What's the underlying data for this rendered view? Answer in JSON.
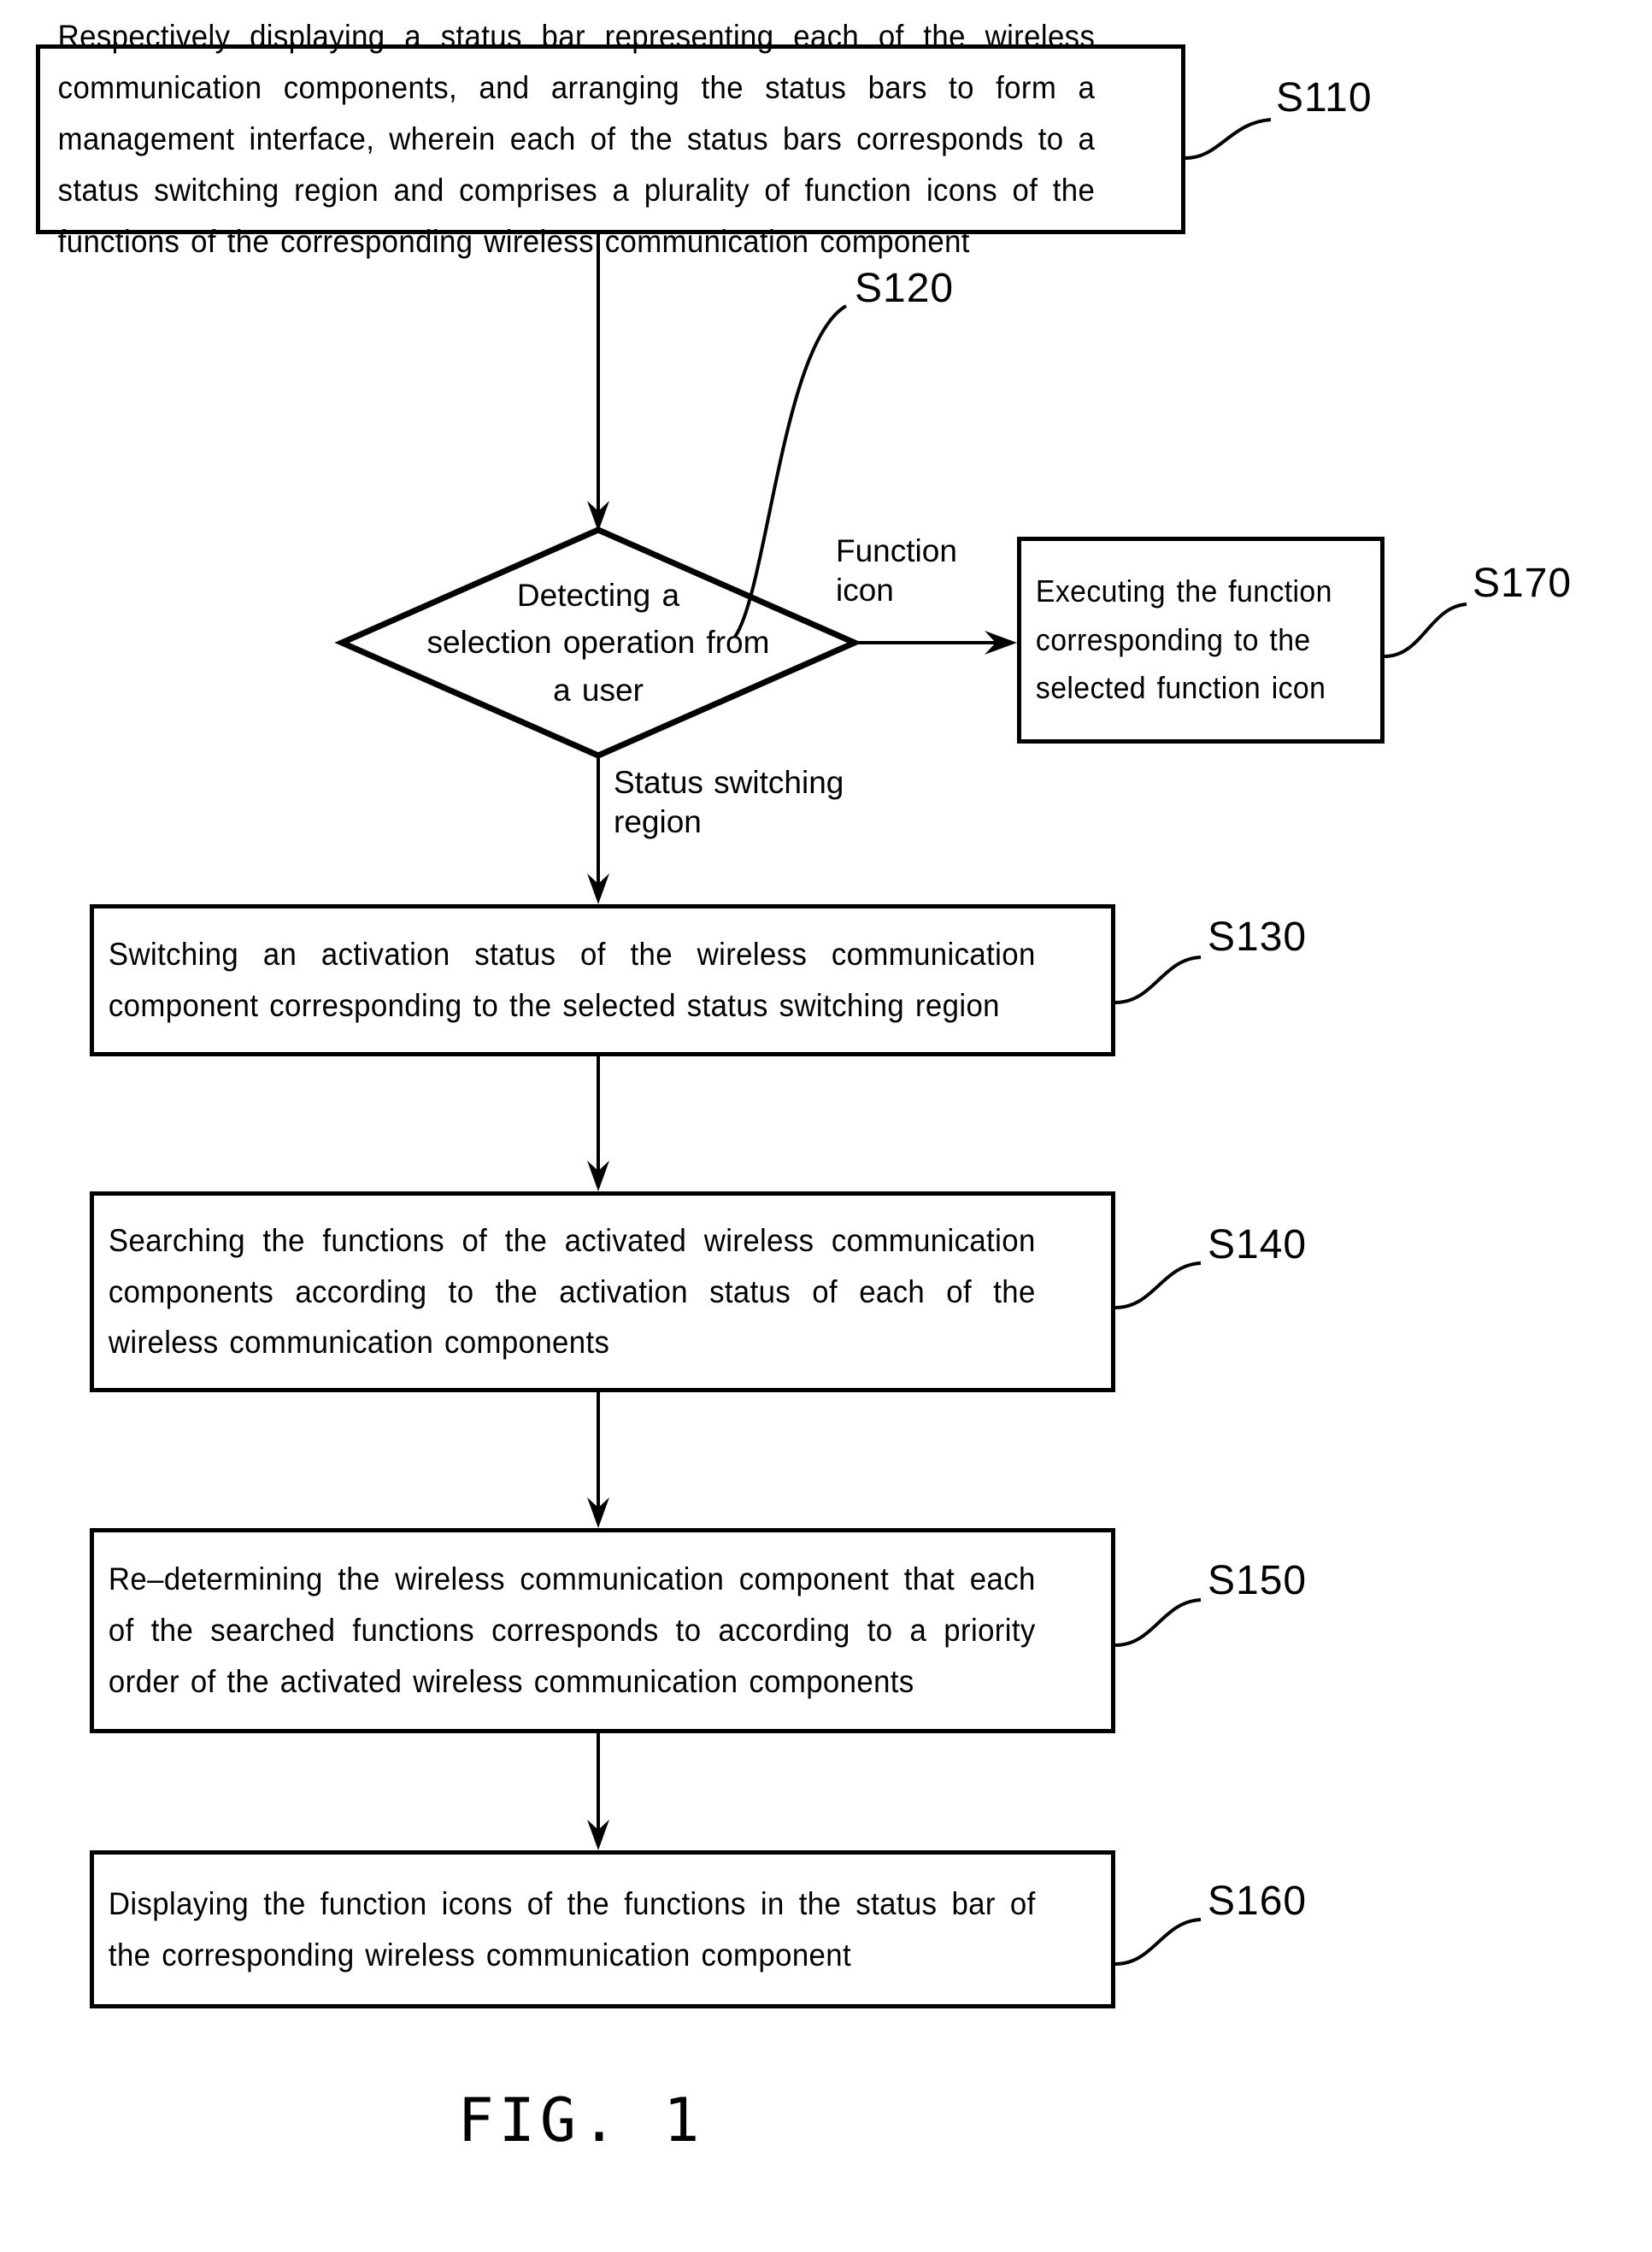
{
  "figure": {
    "caption": "FIG. 1",
    "type": "patent-flowchart"
  },
  "nodes": {
    "s110": {
      "id": "S110",
      "shape": "process",
      "text": "Respectively displaying a status bar representing each of the wireless communication components, and arranging the status bars to form a management interface, wherein each of the status bars corresponds to a status switching region and comprises a plurality of function icons of the functions of the corresponding wireless communication component"
    },
    "s120": {
      "id": "S120",
      "shape": "decision",
      "line1": "Detecting a",
      "line2": "selection operation from",
      "line3": "a user"
    },
    "s170": {
      "id": "S170",
      "shape": "process",
      "text": "Executing the function corresponding to the selected function icon"
    },
    "s130": {
      "id": "S130",
      "shape": "process",
      "text": "Switching an activation status of the wireless communication component corresponding to the selected status switching region"
    },
    "s140": {
      "id": "S140",
      "shape": "process",
      "text": "Searching the functions of the activated wireless communication components according to the activation status of each of the wireless communication components"
    },
    "s150": {
      "id": "S150",
      "shape": "process",
      "text": "Re–determining the wireless communication component that each of the searched functions corresponds to according to a priority order of the activated wireless communication components"
    },
    "s160": {
      "id": "S160",
      "shape": "process",
      "text": "Displaying the function icons of the functions in the status bar of the corresponding wireless communication component"
    }
  },
  "edges": {
    "function_icon": "Function\nicon",
    "status_switching_region": "Status switching\nregion"
  },
  "colors": {
    "stroke": "#000000",
    "background": "#ffffff"
  }
}
